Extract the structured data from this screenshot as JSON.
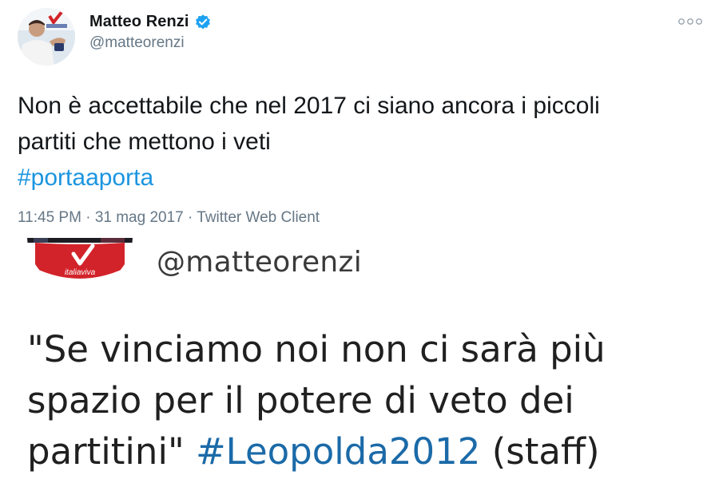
{
  "tweet": {
    "author": {
      "name": "Matteo Renzi",
      "handle": "@matteorenzi",
      "verified": true
    },
    "text_lines": [
      "Non è accettabile che nel 2017 ci siano ancora i piccoli",
      "partiti che mettono i veti"
    ],
    "hashtag": "#portaaporta",
    "meta": {
      "time": "11:45 PM",
      "separator": "·",
      "date": "31 mag 2017",
      "client": "Twitter Web Client"
    },
    "more_icon": "ellipsis-icon"
  },
  "embedded": {
    "avatar_logo_text": "italiaviva",
    "handle": "@matteorenzi",
    "text_lines": [
      "\"Se vinciamo noi non ci sarà più",
      "spazio per il potere di veto dei"
    ],
    "last_line_prefix": "partitini\" ",
    "hashtag": "#Leopolda2012",
    "last_line_suffix": " (staff)"
  },
  "colors": {
    "link": "#1b95e0",
    "secondary_text": "#657786",
    "verified_badge": "#1da1f2",
    "logo_red": "#d2232a"
  }
}
